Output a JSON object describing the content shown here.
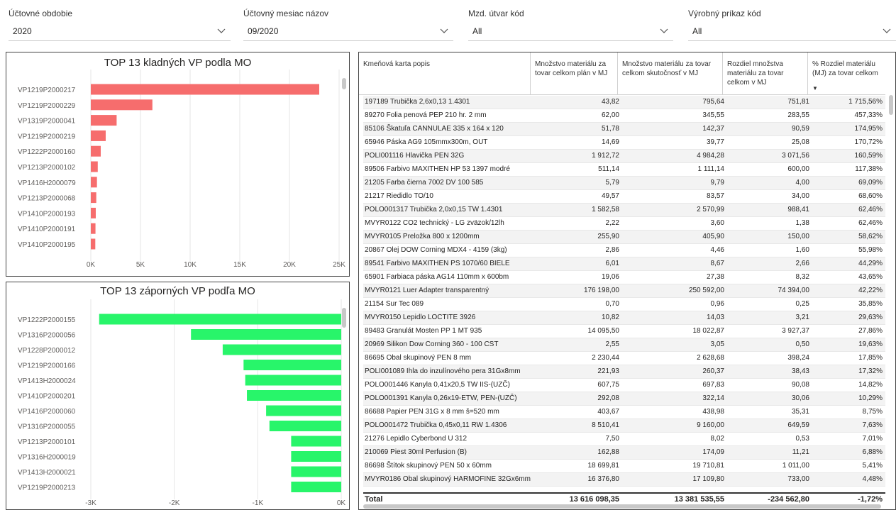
{
  "slicers": [
    {
      "title": "Účtovné obdobie",
      "value": "2020"
    },
    {
      "title": "Účtovný mesiac názov",
      "value": "09/2020"
    },
    {
      "title": "Mzd. útvar kód",
      "value": "All"
    },
    {
      "title": "Výrobný príkaz kód",
      "value": "All"
    }
  ],
  "chart_data": [
    {
      "type": "bar",
      "title": "TOP 13 kladných VP podla MO",
      "categories": [
        "VP1219P2000217",
        "VP1219P2000229",
        "VP1319P2000041",
        "VP1219P2000219",
        "VP1222P2000160",
        "VP1213P2000102",
        "VP1416H2000079",
        "VP1213P2000068",
        "VP1410P2000193",
        "VP1410P2000191",
        "VP1410P2000195"
      ],
      "values": [
        23000,
        6200,
        2600,
        1500,
        1000,
        700,
        620,
        550,
        500,
        470,
        450
      ],
      "xlim": [
        0,
        25000
      ],
      "ticks": [
        "0K",
        "5K",
        "10K",
        "15K",
        "20K",
        "25K"
      ],
      "color": "#f66d6d"
    },
    {
      "type": "bar",
      "title": "TOP 13 záporných VP podľa MO",
      "categories": [
        "VP1222P2000155",
        "VP1316P2000056",
        "VP1228P2000012",
        "VP1219P2000166",
        "VP1413H2000024",
        "VP1410P2000201",
        "VP1416P2000060",
        "VP1316P2000055",
        "VP1213P2000101",
        "VP1316H2000019",
        "VP1413H2000021",
        "VP1219P2000213"
      ],
      "values": [
        -2900,
        -1800,
        -1420,
        -1170,
        -1150,
        -1130,
        -900,
        -860,
        -600,
        -600,
        -600,
        -600
      ],
      "xlim": [
        -3000,
        0
      ],
      "ticks": [
        "-3K",
        "-2K",
        "-1K",
        "0K"
      ],
      "color": "#28f56a"
    }
  ],
  "table": {
    "headers": [
      "Kmeňová karta popis",
      "Množstvo materiálu za tovar celkom plán v MJ",
      "Množstvo materiálu za tovar celkom skutočnosť v MJ",
      "Rozdiel množstva materiálu za tovar celkom v MJ",
      "% Rozdiel materiálu (MJ) za tovar celkom"
    ],
    "rows": [
      [
        "197189 Trubička 2,6x0,13 1.4301",
        "43,82",
        "795,64",
        "751,81",
        "1 715,56%"
      ],
      [
        "89270 Folia penová PEP 210 hr. 2 mm",
        "62,00",
        "345,55",
        "283,55",
        "457,33%"
      ],
      [
        "85106 Škatuľa CANNULAE 335 x 164 x 120",
        "51,78",
        "142,37",
        "90,59",
        "174,95%"
      ],
      [
        "65946 Páska AG9 105mmx300m, OUT",
        "14,69",
        "39,77",
        "25,08",
        "170,72%"
      ],
      [
        "POLI001116 Hlavička PEN 32G",
        "1 912,72",
        "4 984,28",
        "3 071,56",
        "160,59%"
      ],
      [
        "89506 Farbivo MAXITHEN HP 53 1397 modré",
        "511,14",
        "1 111,14",
        "600,00",
        "117,38%"
      ],
      [
        "21205 Farba čierna 7002 DV 100 585",
        "5,79",
        "9,79",
        "4,00",
        "69,09%"
      ],
      [
        "21217 Riedidlo TO/10",
        "49,57",
        "83,57",
        "34,00",
        "68,60%"
      ],
      [
        "POLO001317 Trubička 2,0x0,15 TW 1.4301",
        "1 582,58",
        "2 570,99",
        "988,41",
        "62,46%"
      ],
      [
        "MVYR0122 CO2 technický - LG zväzok/12lh",
        "2,22",
        "3,60",
        "1,38",
        "62,46%"
      ],
      [
        "MVYR0105 Preložka 800 x 1200mm",
        "255,90",
        "405,90",
        "150,00",
        "58,62%"
      ],
      [
        "20867 Olej DOW Corning MDX4 - 4159 (3kg)",
        "2,86",
        "4,46",
        "1,60",
        "55,98%"
      ],
      [
        "89541 Farbivo MAXITHEN PS 1070/60 BIELE",
        "6,01",
        "8,67",
        "2,66",
        "44,29%"
      ],
      [
        "65901 Farbiaca páska AG14 110mm x 600bm",
        "19,06",
        "27,38",
        "8,32",
        "43,65%"
      ],
      [
        "MVYR0121 Luer Adapter transparentný",
        "176 198,00",
        "250 592,00",
        "74 394,00",
        "42,22%"
      ],
      [
        "21154 Sur Tec 089",
        "0,70",
        "0,96",
        "0,25",
        "35,85%"
      ],
      [
        "MVYR0150 Lepidlo LOCTITE 3926",
        "10,82",
        "14,03",
        "3,21",
        "29,63%"
      ],
      [
        "89483 Granulát Mosten PP 1 MT 935",
        "14 095,50",
        "18 022,87",
        "3 927,37",
        "27,86%"
      ],
      [
        "20969 Silikon Dow Corning 360 - 100 CST",
        "2,55",
        "3,05",
        "0,50",
        "19,63%"
      ],
      [
        "86695 Obal skupinový PEN 8 mm",
        "2 230,44",
        "2 628,68",
        "398,24",
        "17,85%"
      ],
      [
        "POLI001089 Ihla do inzulínového pera 31Gx8mm",
        "221,93",
        "260,37",
        "38,43",
        "17,32%"
      ],
      [
        "POLO001446 Kanyla 0,41x20,5 TW IIS-(UZČ)",
        "607,75",
        "697,83",
        "90,08",
        "14,82%"
      ],
      [
        "POLO001391 Kanyla 0,26x19-ETW, PEN-(UZČ)",
        "292,08",
        "322,14",
        "30,06",
        "10,29%"
      ],
      [
        "86688 Papier PEN 31G x 8 mm š=520 mm",
        "403,67",
        "438,98",
        "35,31",
        "8,75%"
      ],
      [
        "POLO001472 Trubička 0,45x0,11 RW 1.4306",
        "8 510,41",
        "9 160,00",
        "649,59",
        "7,63%"
      ],
      [
        "21276 Lepidlo Cyberbond U 312",
        "7,50",
        "8,02",
        "0,53",
        "7,01%"
      ],
      [
        "210069 Piest 30ml Perfusion (B)",
        "162,88",
        "174,09",
        "11,21",
        "6,88%"
      ],
      [
        "86698 Štítok skupinový PEN 50 x 60mm",
        "18 699,81",
        "19 710,81",
        "1 011,00",
        "5,41%"
      ],
      [
        "MVYR0186 Obal skupinový HARMOFINE 32Gx6mm",
        "16 376,80",
        "17 109,80",
        "733,00",
        "4,48%"
      ]
    ],
    "total": [
      "Total",
      "13 616 098,35",
      "13 381 535,55",
      "-234 562,80",
      "-1,72%"
    ]
  }
}
